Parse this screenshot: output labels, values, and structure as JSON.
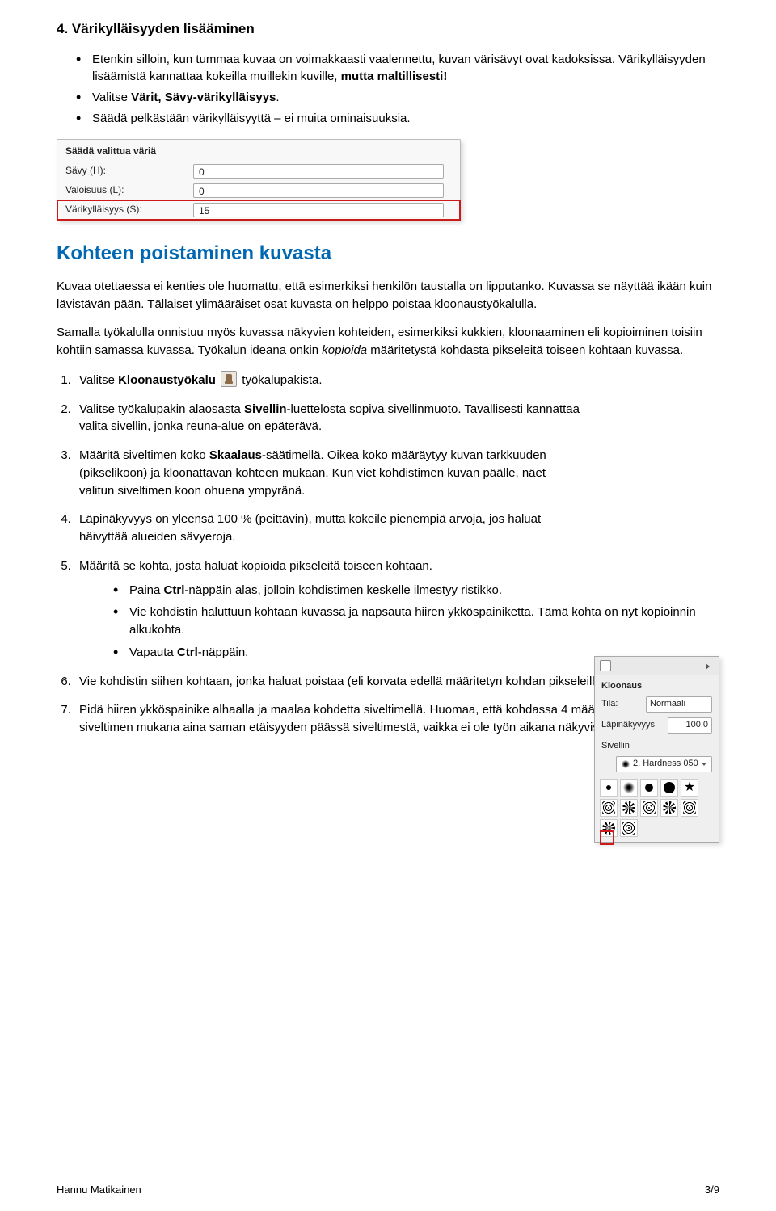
{
  "section4": {
    "heading": "4. Värikylläisyyden lisääminen",
    "bullets": {
      "b1a": "Etenkin silloin, kun tummaa kuvaa on voimakkaasti vaalennettu, kuvan värisävyt ovat kadoksissa. Värikylläisyyden lisäämistä kannattaa kokeilla muillekin kuville, ",
      "b1b": "mutta maltillisesti!",
      "b2a": "Valitse ",
      "b2b": "Värit, Sävy-värikylläisyys",
      "b2c": ".",
      "b3": "Säädä pelkästään värikylläisyyttä – ei muita ominaisuuksia."
    }
  },
  "panel": {
    "title": "Säädä valittua väriä",
    "rows": {
      "hue_label": "Sävy (H):",
      "hue_value": "0",
      "light_label": "Valoisuus (L):",
      "light_value": "0",
      "sat_label": "Värikylläisyys (S):",
      "sat_value": "15"
    }
  },
  "remove": {
    "heading": "Kohteen poistaminen kuvasta",
    "p1": "Kuvaa otettaessa ei kenties ole huomattu, että esimerkiksi henkilön taustalla on lipputanko. Kuvassa se näyttää ikään kuin lävistävän pään. Tällaiset ylimääräiset osat kuvasta on helppo poistaa kloonaustyökalulla.",
    "p2a": "Samalla työkalulla onnistuu myös kuvassa näkyvien kohteiden, esimerkiksi kukkien, kloonaaminen eli kopioiminen toisiin kohtiin samassa kuvassa. Työkalun ideana onkin ",
    "p2b": "kopioida",
    "p2c": " määritetystä kohdasta pikseleitä toiseen kohtaan kuvassa."
  },
  "steps": {
    "s1a": "Valitse ",
    "s1b": "Kloonaustyökalu",
    "s1c": " työkalupakista.",
    "s2a": "Valitse työkalupakin alaosasta ",
    "s2b": "Sivellin",
    "s2c": "-luettelosta sopiva sivellinmuoto. Tavallisesti kannattaa valita sivellin, jonka reuna-alue on epäterävä.",
    "s3a": "Määritä siveltimen koko ",
    "s3b": "Skaalaus",
    "s3c": "-säätimellä. Oikea koko määräytyy kuvan tarkkuuden (pikselikoon) ja kloonattavan kohteen mukaan. Kun viet kohdistimen kuvan päälle, näet valitun siveltimen koon ohuena ympyränä.",
    "s4": "Läpinäkyvyys on yleensä 100 % (peittävin), mutta kokeile pienempiä arvoja, jos haluat häivyttää alueiden sävyeroja.",
    "s5": "Määritä se kohta, josta haluat kopioida pikseleitä toiseen kohtaan.",
    "s5n1a": "Paina ",
    "s5n1b": "Ctrl",
    "s5n1c": "-näppäin alas, jolloin kohdistimen keskelle ilmestyy ristikko.",
    "s5n2": "Vie kohdistin haluttuun kohtaan kuvassa ja napsauta hiiren ykköspainiketta. Tämä kohta on nyt kopioinnin alkukohta.",
    "s5n3a": "Vapauta ",
    "s5n3b": "Ctrl",
    "s5n3c": "-näppäin.",
    "s6": "Vie kohdistin siihen kohtaan, jonka haluat poistaa (eli korvata edellä määritetyn kohdan pikseleillä).",
    "s7": "Pidä hiiren ykköspainike alhaalla ja maalaa kohdetta siveltimellä. Huomaa, että kohdassa 4 määritetty kohta liikkuu siveltimen mukana aina saman etäisyyden päässä siveltimestä, vaikka ei ole työn aikana näkyvissä."
  },
  "clone_palette": {
    "title": "Kloonaus",
    "mode_label": "Tila:",
    "mode_value": "Normaali",
    "opacity_label": "Läpinäkyvyys",
    "opacity_value": "100,0",
    "brush_section": "Sivellin",
    "brush_selected": "2. Hardness 050"
  },
  "footer": {
    "author": "Hannu Matikainen",
    "page": "3/9"
  }
}
